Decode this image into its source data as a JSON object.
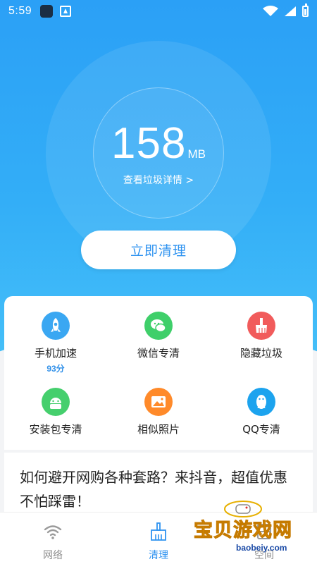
{
  "status_bar": {
    "time": "5:59"
  },
  "hero": {
    "junk_size_value": "158",
    "junk_size_unit": "MB",
    "details_link": "查看垃圾详情 >",
    "clean_button": "立即清理"
  },
  "tools": [
    {
      "label": "手机加速",
      "sub": "93分",
      "icon": "rocket-icon",
      "color": "#3aa7f2"
    },
    {
      "label": "微信专清",
      "sub": "",
      "icon": "wechat-icon",
      "color": "#3fcf6a"
    },
    {
      "label": "隐藏垃圾",
      "sub": "",
      "icon": "broom-icon",
      "color": "#f15b5b"
    },
    {
      "label": "安装包专清",
      "sub": "",
      "icon": "android-icon",
      "color": "#45cf6d"
    },
    {
      "label": "相似照片",
      "sub": "",
      "icon": "photo-icon",
      "color": "#ff8a2a"
    },
    {
      "label": "QQ专清",
      "sub": "",
      "icon": "qq-penguin-icon",
      "color": "#1ca3ee"
    }
  ],
  "news": {
    "headline": "如何避开网购各种套路？来抖音，超值优惠不怕踩雷！"
  },
  "tabs": [
    {
      "label": "网络",
      "icon": "wifi-icon",
      "active": false
    },
    {
      "label": "清理",
      "icon": "clean-brush-icon",
      "active": true
    },
    {
      "label": "空间",
      "icon": "storage-icon",
      "active": false
    }
  ],
  "watermark": {
    "text": "宝贝游戏网",
    "url": "baobeiy.com"
  },
  "colors": {
    "accent": "#2f93f0",
    "hero_top": "#2ba0f6",
    "hero_bottom": "#46c0f8"
  }
}
